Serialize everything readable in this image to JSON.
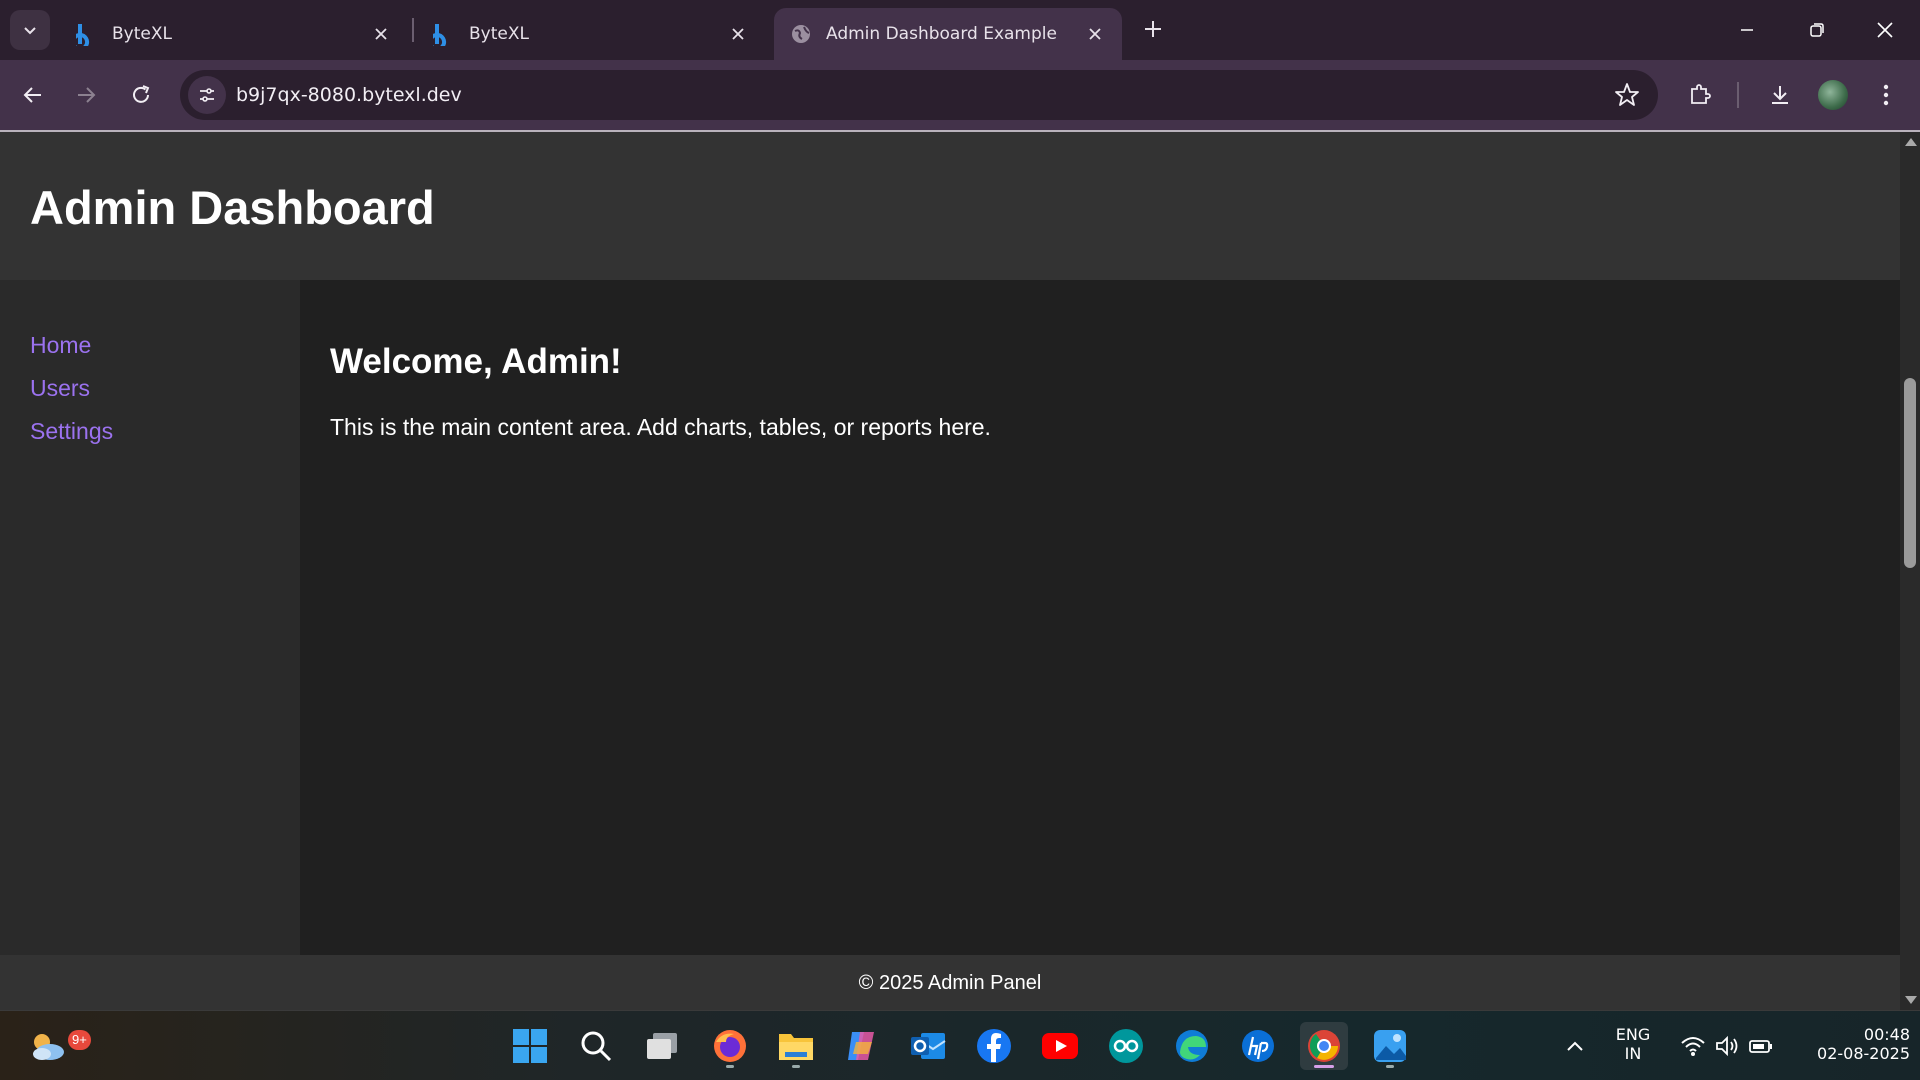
{
  "browser": {
    "tabs": [
      {
        "title": "ByteXL",
        "icon": "bytexl-favicon-icon",
        "active": false
      },
      {
        "title": "ByteXL",
        "icon": "bytexl-favicon-icon",
        "active": false
      },
      {
        "title": "Admin Dashboard Example",
        "icon": "globe-icon",
        "active": true
      }
    ],
    "url": "b9j7qx-8080.bytexl.dev",
    "accent_color": "#43324a"
  },
  "page": {
    "header_title": "Admin Dashboard",
    "nav": [
      {
        "label": "Home"
      },
      {
        "label": "Users"
      },
      {
        "label": "Settings"
      }
    ],
    "main_heading": "Welcome, Admin!",
    "main_text": "This is the main content area. Add charts, tables, or reports here.",
    "footer_text": "© 2025 Admin Panel",
    "link_color": "#9b72ef"
  },
  "taskbar": {
    "weather_badge": "9+",
    "apps": [
      "start-icon",
      "search-icon",
      "task-view-icon",
      "firefox-icon",
      "file-explorer-icon",
      "copilot-icon",
      "outlook-icon",
      "facebook-icon",
      "youtube-icon",
      "arduino-icon",
      "edge-icon",
      "hp-icon",
      "chrome-icon",
      "photos-icon"
    ],
    "language": "ENG",
    "region": "IN",
    "time": "00:48",
    "date": "02-08-2025"
  }
}
